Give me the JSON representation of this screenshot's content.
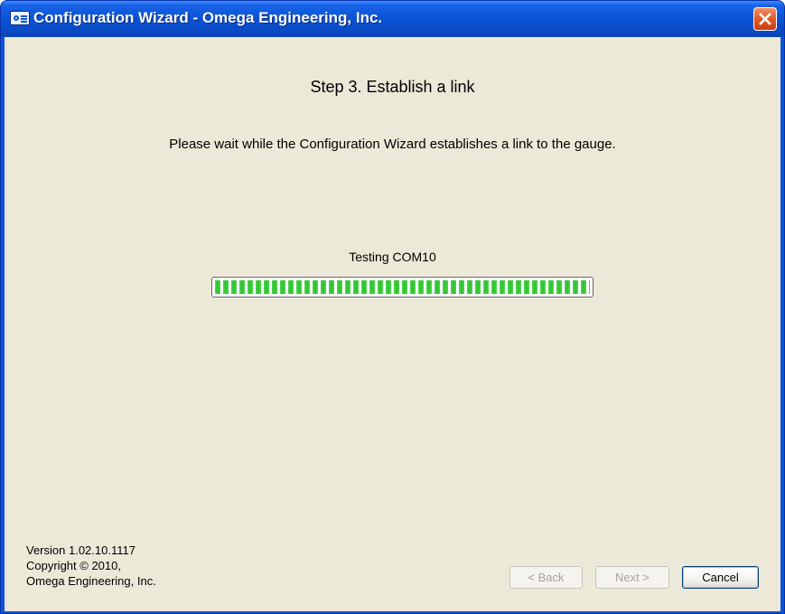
{
  "window": {
    "title": "Configuration Wizard - Omega Engineering, Inc.",
    "app_icon": "omega-app-icon",
    "close_icon": "close-icon"
  },
  "wizard": {
    "step_title": "Step 3.  Establish a link",
    "instructions": "Please wait while the Configuration Wizard establishes a link to the gauge.",
    "status_text": "Testing COM10",
    "progress_percent": 100,
    "progress_color": "#3ccd3c"
  },
  "footer": {
    "version": "Version 1.02.10.1117",
    "copyright": "Copyright © 2010,",
    "company": "Omega Engineering, Inc."
  },
  "buttons": {
    "back": "< Back",
    "next": "Next >",
    "cancel": "Cancel"
  }
}
